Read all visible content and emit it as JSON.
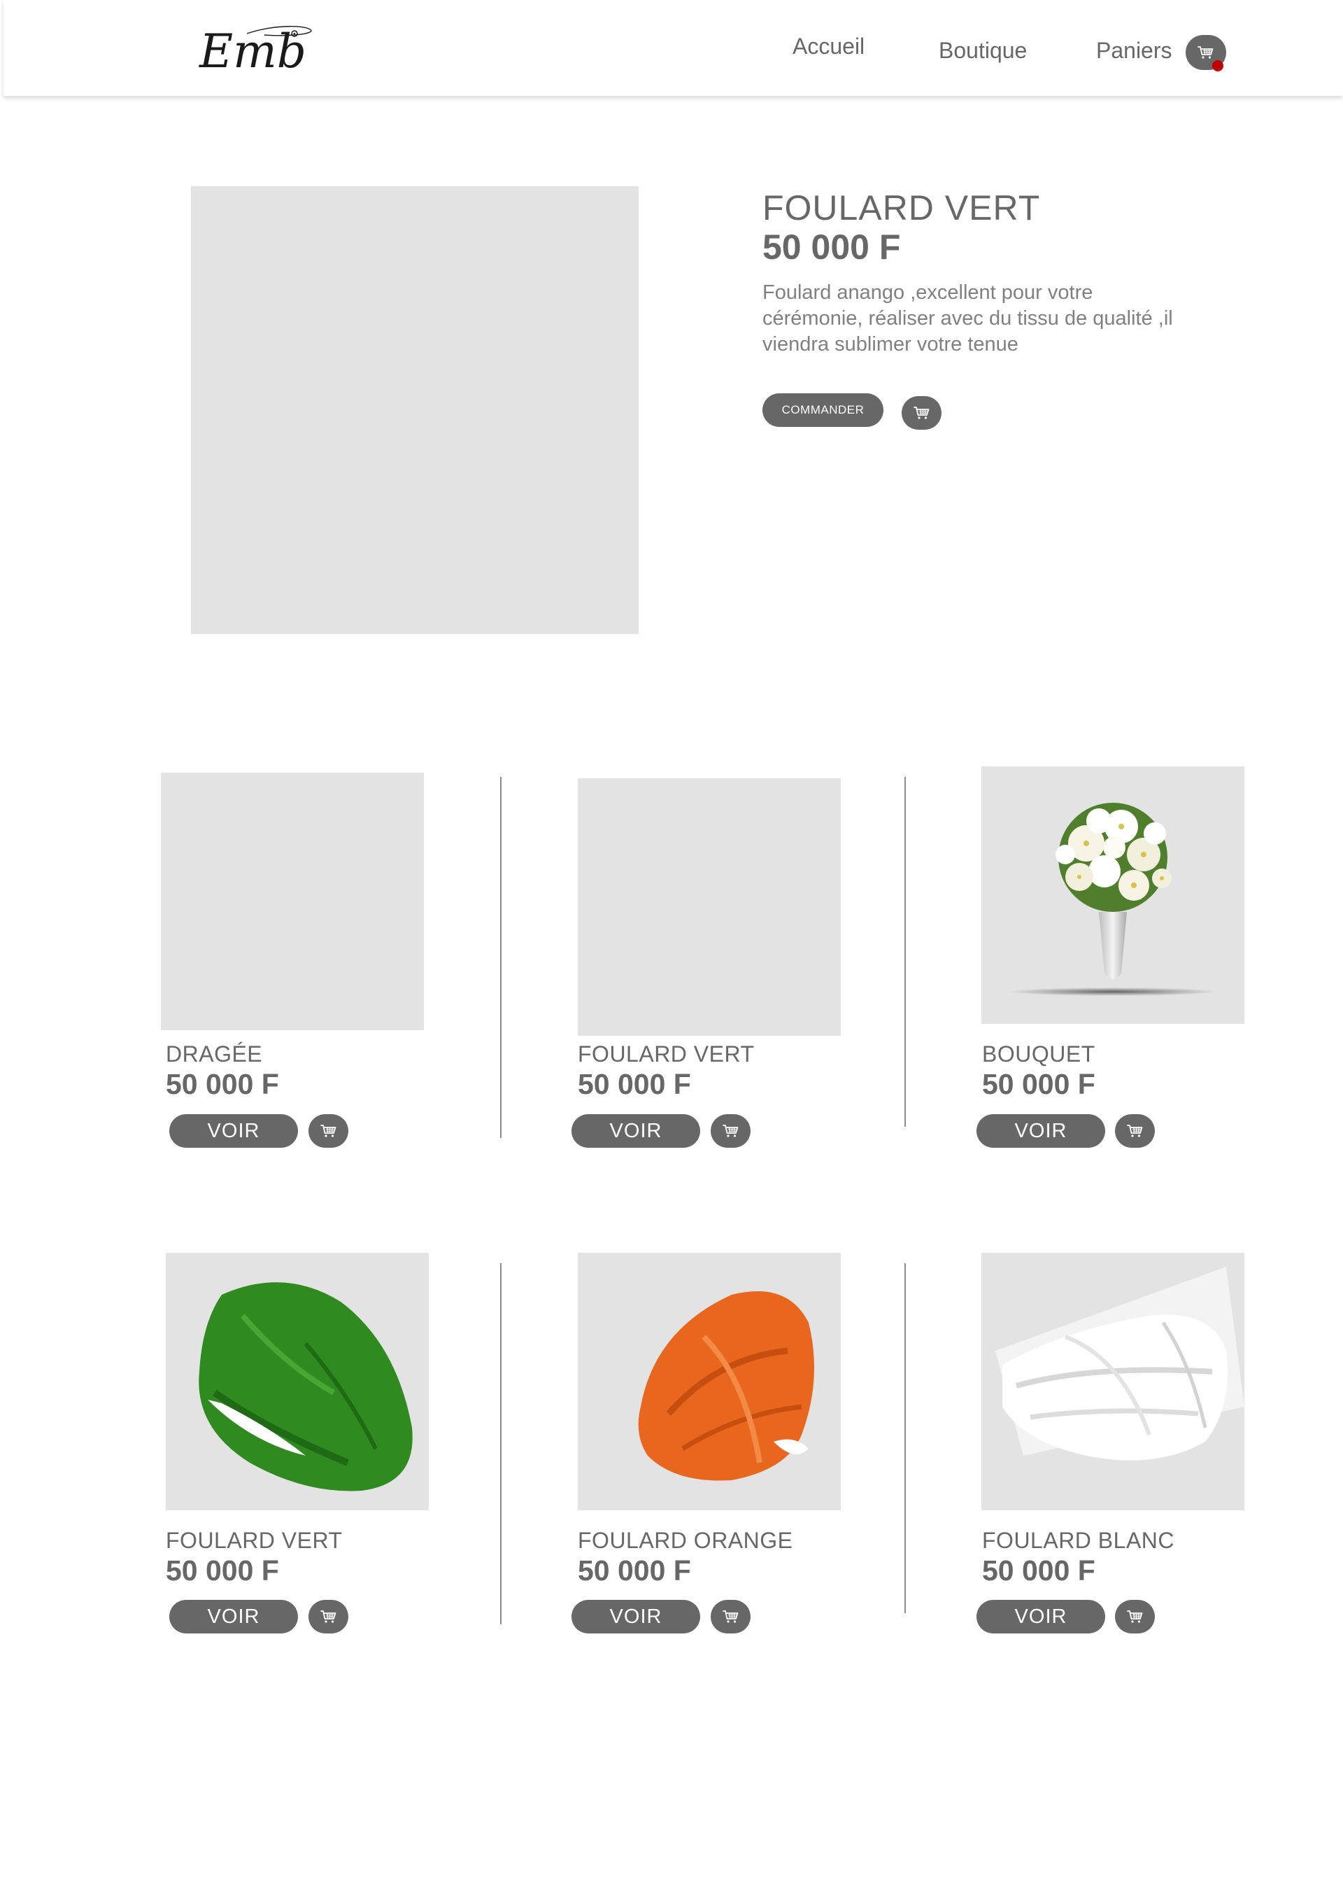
{
  "header": {
    "logo_text": "Emb",
    "nav": {
      "accueil": "Accueil",
      "boutique": "Boutique",
      "paniers": "Paniers"
    }
  },
  "featured": {
    "name": "FOULARD VERT",
    "price": "50 000 F",
    "description": "Foulard anango ,excellent pour votre cérémonie, réaliser avec du tissu de qualité ,il viendra sublimer votre tenue",
    "order_label": "COMMANDER"
  },
  "products": [
    {
      "name": "DRAGÉE",
      "price": "50 000 F",
      "action": "VOIR",
      "image": "placeholder"
    },
    {
      "name": "FOULARD VERT",
      "price": "50 000 F",
      "action": "VOIR",
      "image": "placeholder"
    },
    {
      "name": "BOUQUET",
      "price": "50 000 F",
      "action": "VOIR",
      "image": "white-bouquet-in-vase"
    },
    {
      "name": "FOULARD VERT",
      "price": "50 000 F",
      "action": "VOIR",
      "image": "green-headwrap",
      "color": "#2e8b1e"
    },
    {
      "name": "FOULARD ORANGE",
      "price": "50 000 F",
      "action": "VOIR",
      "image": "orange-headwrap",
      "color": "#e8661e"
    },
    {
      "name": "FOULARD BLANC",
      "price": "50 000 F",
      "action": "VOIR",
      "image": "white-headwrap",
      "color": "#e6e6e6"
    }
  ],
  "colors": {
    "primary": "#676767",
    "placeholder": "#e3e3e3",
    "badge": "#c10000"
  }
}
